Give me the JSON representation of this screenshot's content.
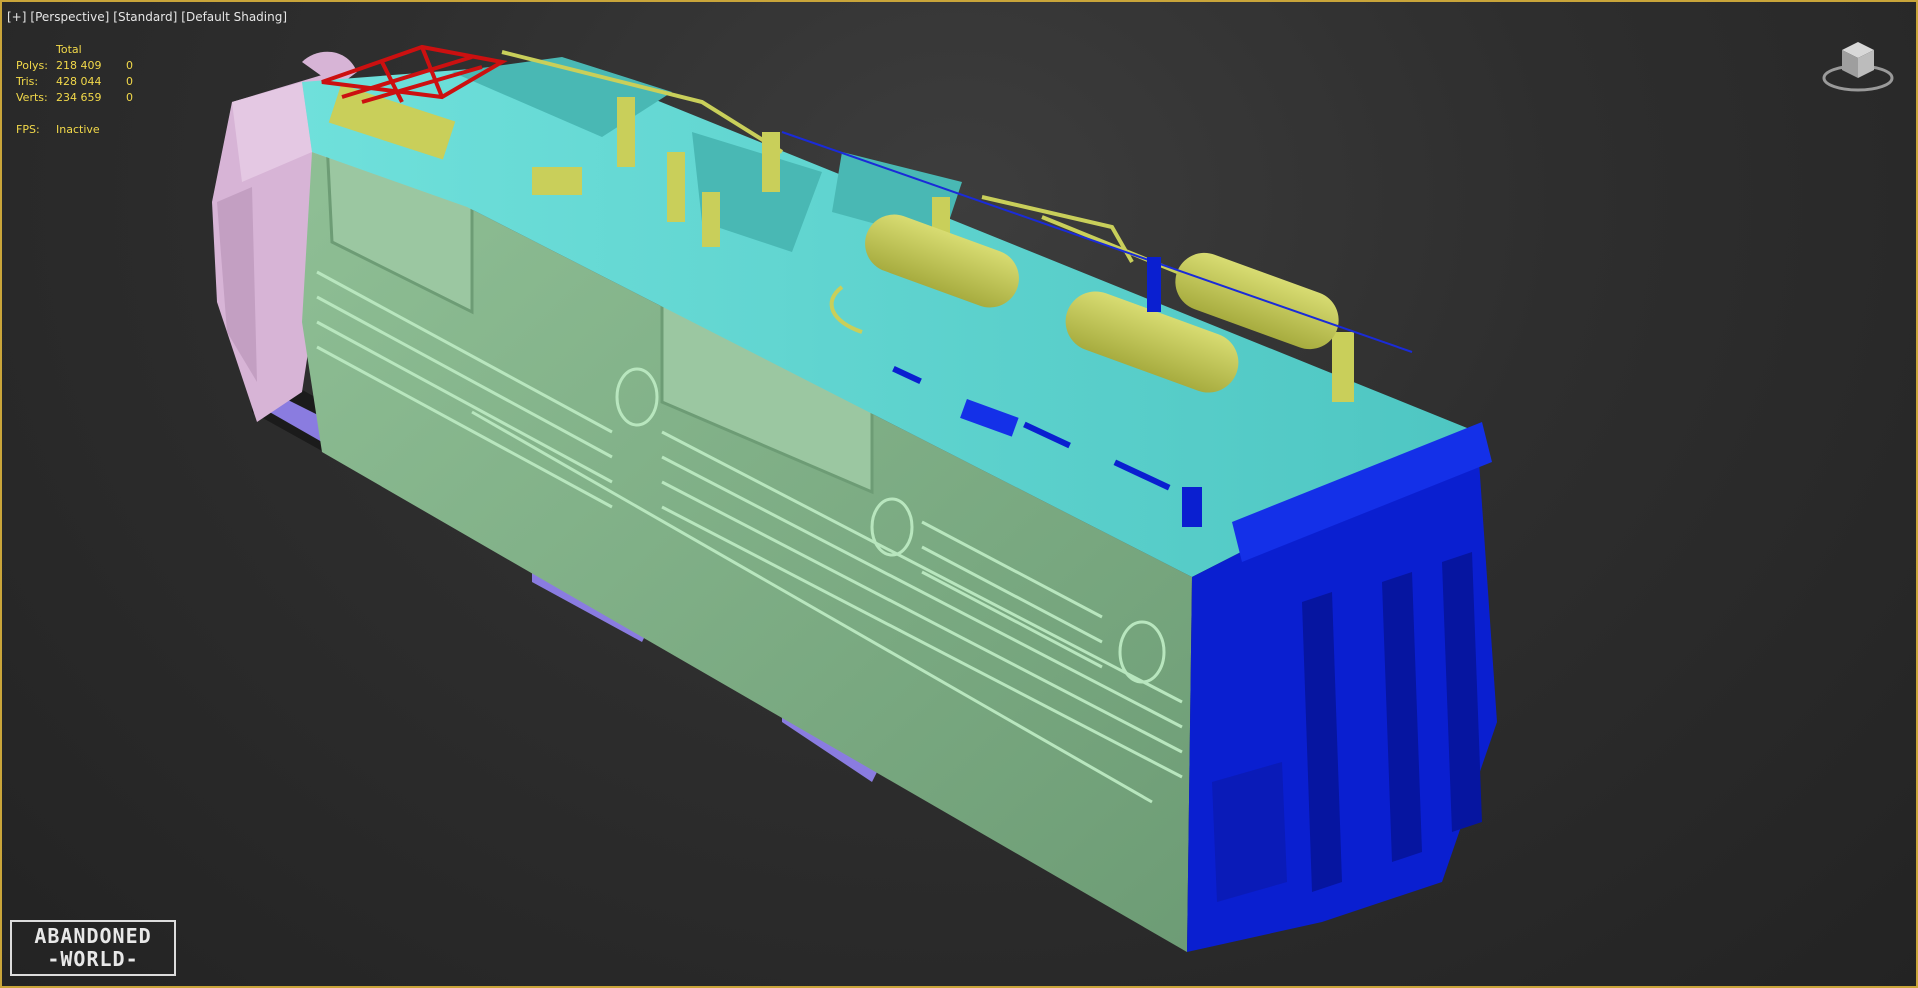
{
  "viewport": {
    "labels": [
      "[+]",
      "[Perspective]",
      "[Standard]",
      "[Default Shading]"
    ],
    "border_color": "#c9a53a"
  },
  "stats": {
    "header": "Total",
    "rows": [
      {
        "label": "Polys:",
        "total": "218 409",
        "selected": "0"
      },
      {
        "label": "Tris:",
        "total": "428 044",
        "selected": "0"
      },
      {
        "label": "Verts:",
        "total": "234 659",
        "selected": "0"
      }
    ],
    "fps_label": "FPS:",
    "fps_value": "Inactive",
    "color": "#f2d94a"
  },
  "model_colors": {
    "body_side": "#7fae86",
    "roof": "#5fd3cf",
    "end_cab": "#0a1fd0",
    "rear_cab": "#d7b4d6",
    "equipment": "#c9cf5a",
    "pantograph": "#cc1010",
    "bogie": "#8a7ce0"
  },
  "icons": {
    "viewcube": "viewcube-icon"
  },
  "watermark": {
    "line1": "ABANDONED",
    "line2": "-WORLD-"
  }
}
